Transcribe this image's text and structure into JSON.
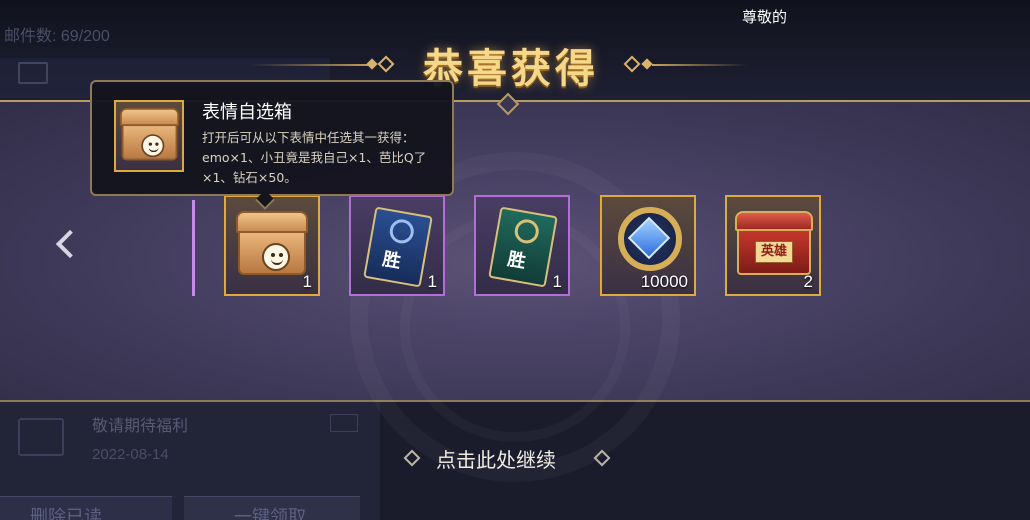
{
  "background": {
    "mail_count": "邮件数: 69/200",
    "top_right_text": "尊敬的",
    "mail_item_title": "敬请期待福利",
    "mail_item_date": "2022-08-14",
    "delete_read_label": "删除已读",
    "claim_all_label": "一键领取"
  },
  "reward": {
    "title": "恭喜获得",
    "items": [
      {
        "name": "表情自选箱",
        "icon": "emoji-chest-icon",
        "count": "1",
        "rarity": "gold"
      },
      {
        "name": "blue-victory-card",
        "icon": "victory-card-blue-icon",
        "badge": "胜",
        "count": "1",
        "rarity": "purple"
      },
      {
        "name": "green-victory-card",
        "icon": "victory-card-green-icon",
        "badge": "胜",
        "count": "1",
        "rarity": "purple"
      },
      {
        "name": "钻石",
        "icon": "diamond-icon",
        "count": "10000",
        "rarity": "gold"
      },
      {
        "name": "hero-chest",
        "icon": "hero-chest-icon",
        "badge": "英雄",
        "count": "2",
        "rarity": "gold"
      }
    ],
    "continue_label": "点击此处继续"
  },
  "tooltip": {
    "title": "表情自选箱",
    "description": "打开后可从以下表情中任选其一获得：emo×1、小丑竟是我自己×1、芭比Q了×1、钻石×50。"
  },
  "colors": {
    "gold_border": "#e0a93c",
    "purple_border": "#b36ed8",
    "title_gold": "#f6d88a"
  }
}
